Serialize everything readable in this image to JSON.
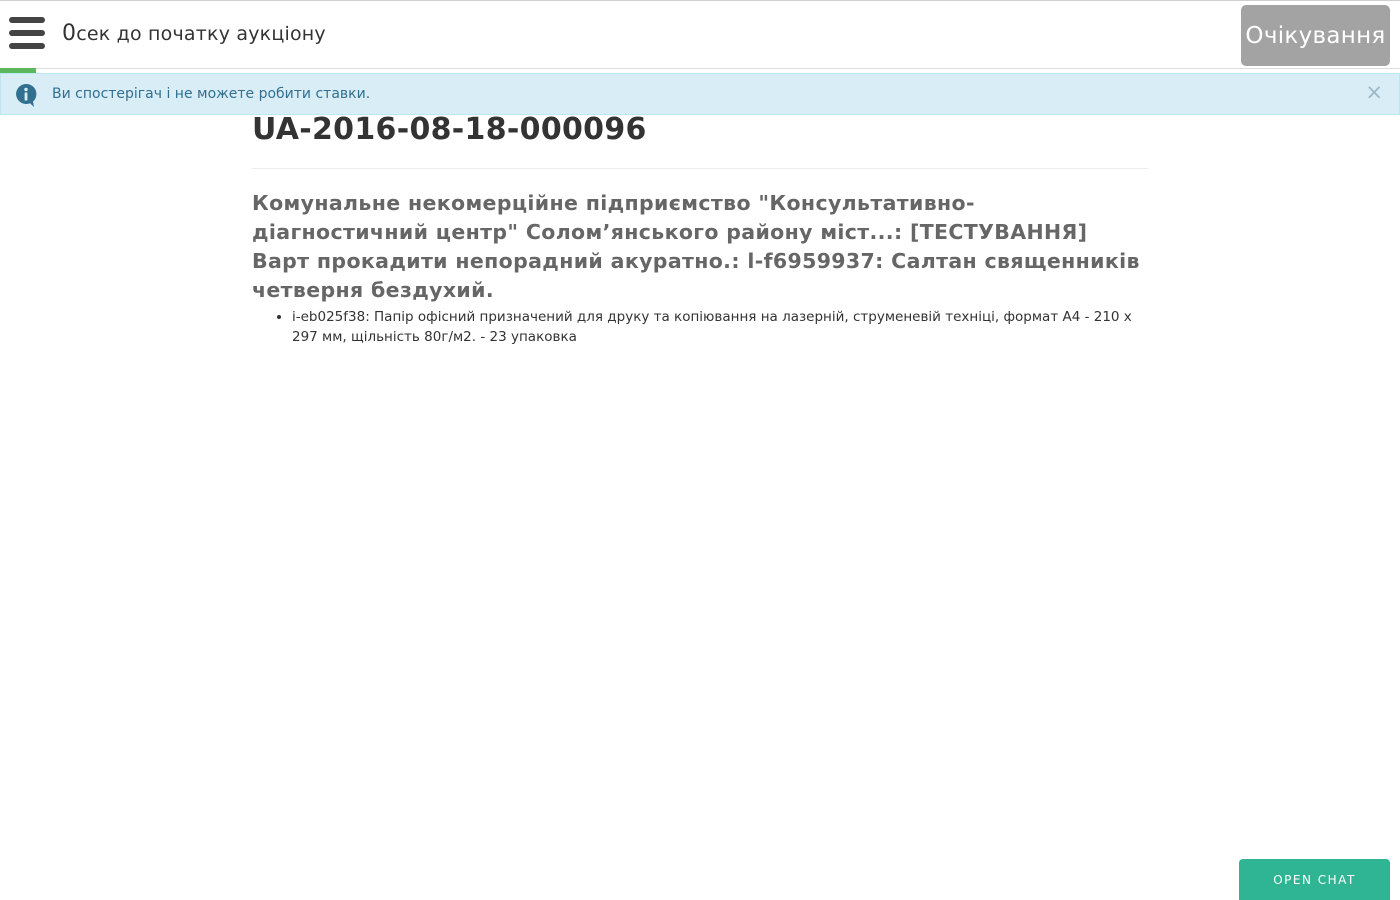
{
  "header": {
    "countdown_value": "0",
    "countdown_label": "сек до початку аукціону",
    "status_label": "Очікування"
  },
  "progress": {
    "fraction": 0.026,
    "color": "#5cb85c"
  },
  "alert": {
    "text": "Ви спостерігач і не можете робити ставки.",
    "close_label": "×"
  },
  "auction": {
    "id": "UA-2016-08-18-000096",
    "description": "Комунальне некомерційне підприємство \"Консультативно-діагностичний центр\" Солом’янського району міст...: [ТЕСТУВАННЯ] Варт прокадити непорадний акуратно.: l-f6959937: Салтан священників четверня бездухий.",
    "items": [
      "i-eb025f38: Папір офісний призначений для друку та копіювання на лазерній, струменевій техніці, формат А4 - 210 х 297 мм, щільність 80г/м2. - 23 упаковка"
    ]
  },
  "chat": {
    "button_label": "OPEN CHAT"
  },
  "colors": {
    "alert_bg": "#d9edf7",
    "alert_text": "#31708f",
    "status_bg": "#a3a3a3",
    "chat_bg": "#2fb593"
  },
  "icons": {
    "menu": "hamburger-menu-icon",
    "info": "info-icon",
    "close": "close-icon"
  }
}
